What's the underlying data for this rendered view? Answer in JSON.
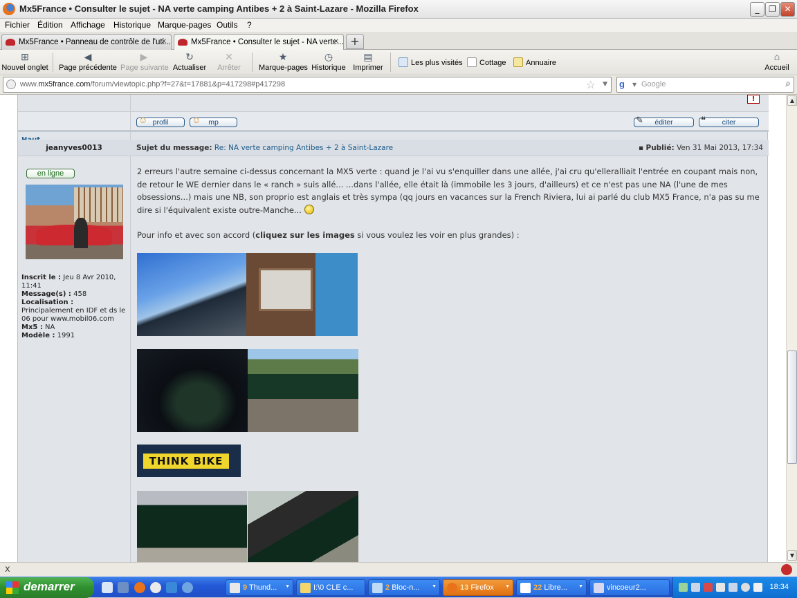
{
  "window": {
    "title": "Mx5France • Consulter le sujet - NA verte camping Antibes + 2 à Saint-Lazare - Mozilla Firefox",
    "buttons": {
      "minimize": "_",
      "restore": "❐",
      "close": "✕"
    }
  },
  "menu": [
    "Fichier",
    "Édition",
    "Affichage",
    "Historique",
    "Marque-pages",
    "Outils",
    "?"
  ],
  "tabs": [
    {
      "label": "Mx5France • Panneau de contrôle de l'uti...",
      "active": false
    },
    {
      "label": "Mx5France • Consulter le sujet - NA verte...",
      "active": true
    }
  ],
  "toolbar": {
    "new_tab": "Nouvel onglet",
    "back": "Page précédente",
    "forward": "Page suivante",
    "reload": "Actualiser",
    "stop": "Arrêter",
    "bookmarks": "Marque-pages",
    "history": "Historique",
    "print": "Imprimer",
    "home": "Accueil",
    "bookmarks_bar": [
      "Les plus visités",
      "Cottage",
      "Annuaire"
    ]
  },
  "urlbar": {
    "prefix": "www.",
    "domain": "mx5france.com",
    "path": "/forum/viewtopic.php?f=27&t=17881&p=417298#p417298"
  },
  "search": {
    "placeholder": "Google"
  },
  "forum": {
    "top_link": "Haut",
    "post_buttons": {
      "profile": "profil",
      "pm": "mp",
      "edit": "éditer",
      "quote": "citer"
    },
    "post": {
      "author": "jeanyves0013",
      "subject_label": "Sujet du message:",
      "subject": "Re: NA verte camping Antibes + 2 à Saint-Lazare",
      "posted_label": "Publié:",
      "posted_date": "Ven 31 Mai 2013, 17:34",
      "status": "en ligne",
      "profile": {
        "registered_label": "Inscrit le :",
        "registered": "Jeu 8 Avr 2010, 11:41",
        "messages_label": "Message(s) :",
        "messages": "458",
        "location_label": "Localisation :",
        "location": "Principalement en IDF et ds le 06 pour www.mobil06.com",
        "mx5_label": "Mx5 :",
        "mx5": "NA",
        "model_label": "Modèle :",
        "model": "1991"
      },
      "body_p1": "2 erreurs l'autre semaine ci-dessus concernant la MX5 verte : quand je l'ai vu s'enquiller dans une allée, j'ai cru qu'elleralliait l'entrée en coupant mais non, de retour le WE dernier dans le « ranch » suis allé... ...dans l'allée, elle était là (immobile les 3 jours, d'ailleurs) et ce n'est pas une NA (l'une de mes obsessions...) mais une NB, son proprio est anglais et très sympa (qq jours en vacances sur la French Riviera, lui ai parlé du club MX5 France, n'a pas su me dire si l'équivalent existe outre-Manche...",
      "body_p2_a": "Pour info et avec son accord (",
      "body_p2_bold": "cliquez sur les images",
      "body_p2_b": " si vous voulez les voir en plus grandes) :",
      "sign_text": "THINK BIKE"
    }
  },
  "status": {
    "close": "x"
  },
  "taskbar": {
    "start": "demarrer",
    "tasks": [
      {
        "count": "9",
        "label": "Thund..."
      },
      {
        "count": "",
        "label": "I:\\0 CLE c..."
      },
      {
        "count": "2",
        "label": "Bloc-n..."
      },
      {
        "count": "13",
        "label": "Firefox"
      },
      {
        "count": "22",
        "label": "Libre..."
      },
      {
        "count": "",
        "label": "vincoeur2..."
      }
    ],
    "clock": "18:34"
  }
}
